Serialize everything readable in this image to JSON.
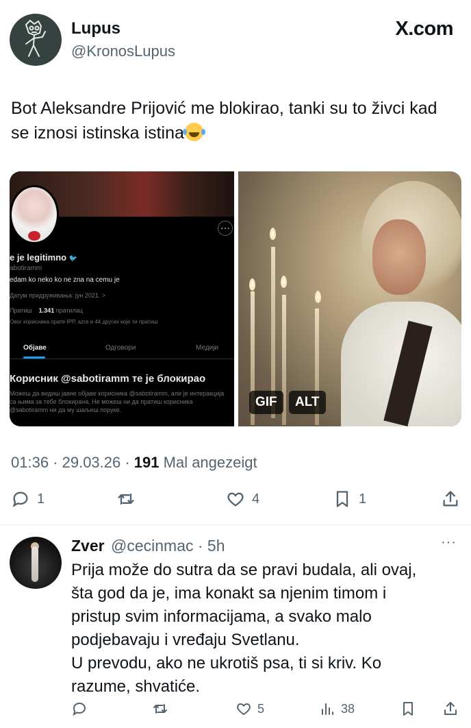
{
  "author": {
    "name": "Lupus",
    "handle": "@KronosLupus"
  },
  "brand": "X.com",
  "tweet": {
    "text": "Bot Aleksandre Prijović me blokirao, tanki su to živci kad se iznosi istinska istina",
    "emoji_icon": "face-with-tears-of-joy-icon",
    "time": "01:36 · 29.03.26 · ",
    "views_count": "191",
    "views_label": " Mal angezeigt"
  },
  "screenshot_media": {
    "display_name": "e je legitimno",
    "handle": "abotiramm",
    "bio": "edam ko neko ko ne zna na cemu je",
    "joined": "Датум придруживања: јун 2021. >",
    "following_label": "Пратиш",
    "followers_count": "1.341",
    "followers_label": "пратилац",
    "mutuals": "Овог корисника прате IPP, azra и 44 других које ти пратиш",
    "tabs": [
      "Објаве",
      "Одговори",
      "Медији"
    ],
    "blocked_title": "Корисник @sabotiramm те је блокирао",
    "blocked_text": "Можеш да видиш јавне објаве корисника @sabotiramm,  али је интеракција са њима за тебе блокирана. Не можеш ни да пратиш корисника @sabotiramm ни да му шаљеш поруке."
  },
  "gif_media": {
    "gif_badge": "GIF",
    "alt_badge": "ALT"
  },
  "tweet_actions": {
    "replies": "1",
    "retweets": "",
    "likes": "4",
    "bookmarks": "1"
  },
  "reply": {
    "name": "Zver",
    "handle_time": "@cecinmac · 5h",
    "more": "···",
    "text_lines": [
      "Prija može do sutra da se pravi budala, ali ovaj,",
      "šta god da je, ima konakt sa njenim timom i",
      "pristup svim informacijama, a svako malo",
      "podjebavaju i vređaju Svetlanu.",
      "U prevodu, ako ne ukrotiš psa, ti si kriv. Ko",
      "razume, shvatiće."
    ],
    "likes": "5",
    "views": "38"
  },
  "colors": {
    "text": "#0f1419",
    "secondary": "#536471",
    "divider": "#eff3f4",
    "accent": "#1d9bf0"
  }
}
